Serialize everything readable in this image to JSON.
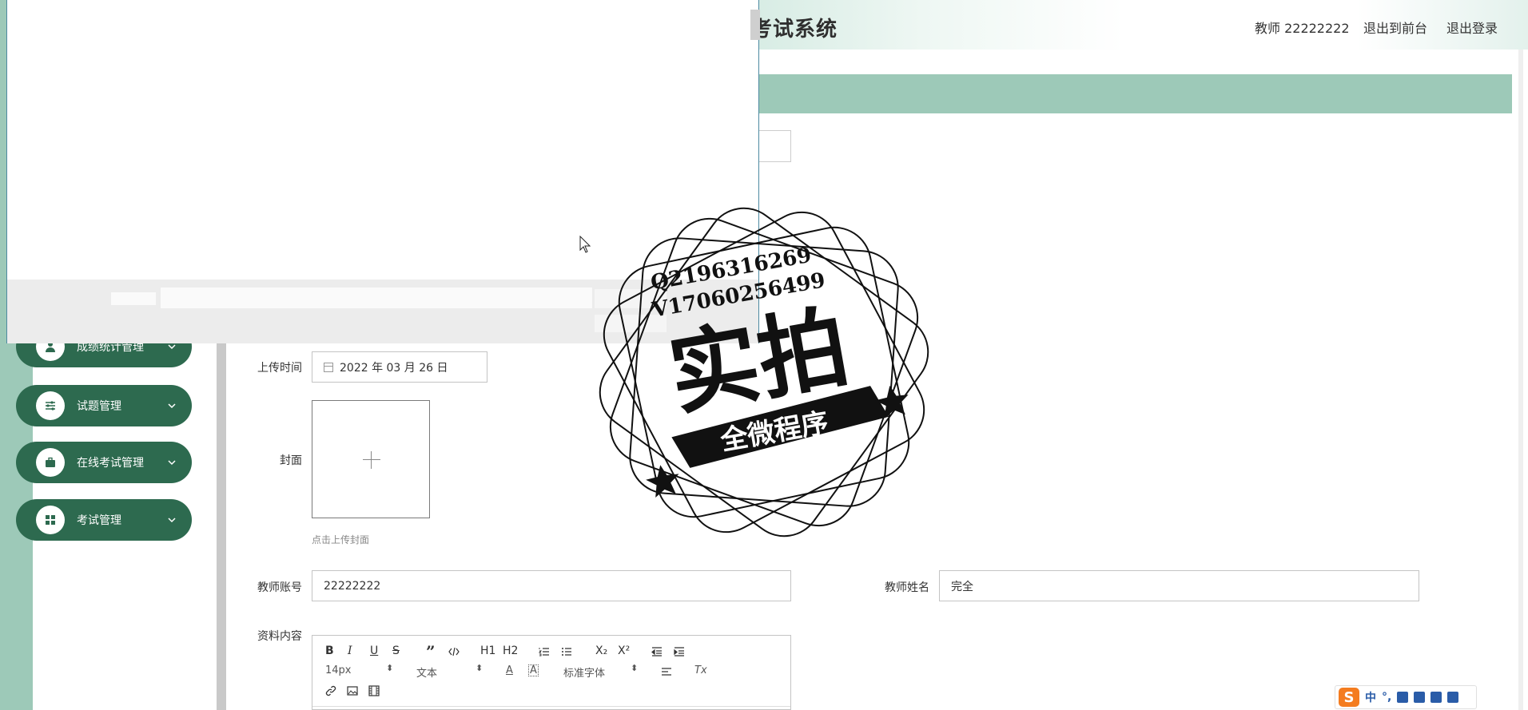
{
  "header": {
    "title": "考试系统",
    "user": "教师 22222222",
    "back_to_front": "退出到前台",
    "logout": "退出登录"
  },
  "sidebar": {
    "items": [
      {
        "label": "成绩统计管理",
        "icon": "user-icon"
      },
      {
        "label": "试题管理",
        "icon": "sliders-icon"
      },
      {
        "label": "在线考试管理",
        "icon": "briefcase-icon"
      },
      {
        "label": "考试管理",
        "icon": "grid-icon"
      }
    ]
  },
  "form": {
    "upload_time_label": "上传时间",
    "upload_time_value": "2022 年 03 月 26 日",
    "cover_label": "封面",
    "cover_hint": "点击上传封面",
    "teacher_account_label": "教师账号",
    "teacher_account_value": "22222222",
    "teacher_name_label": "教师姓名",
    "teacher_name_value": "完全",
    "content_label": "资料内容"
  },
  "editor": {
    "font_size": "14px",
    "block_type": "文本",
    "font_family": "标准字体",
    "bold": "B",
    "italic": "I",
    "underline": "U",
    "strike": "S",
    "quote": "”",
    "h1": "H1",
    "h2": "H2",
    "sub": "X₂",
    "sup": "X²",
    "color": "A",
    "bg": "A",
    "clear": "Tx"
  },
  "watermark": {
    "qq": "Q2196316269",
    "vx": "V17060256499",
    "main": "实拍",
    "banner": "全微程序"
  },
  "ime": {
    "logo": "S",
    "lang": "中"
  },
  "colors": {
    "brand_green": "#2d6a4f",
    "mint": "#9dc9b8"
  }
}
